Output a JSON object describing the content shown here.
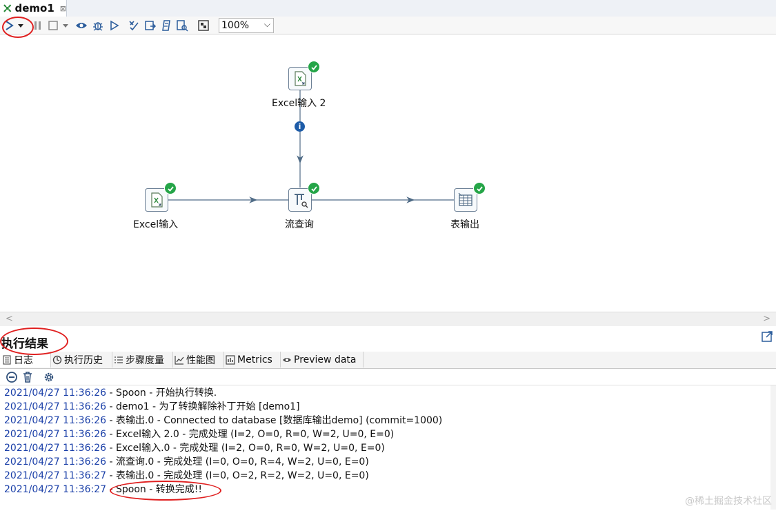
{
  "tab": {
    "title": "demo1",
    "close": "⊠"
  },
  "toolbar": {
    "zoom": "100%"
  },
  "canvas": {
    "nodes": [
      {
        "label": "Excel输入 2"
      },
      {
        "label": "Excel输入"
      },
      {
        "label": "流查询"
      },
      {
        "label": "表输出"
      }
    ],
    "info_badge": "i"
  },
  "results": {
    "title": "执行结果",
    "tabs": [
      {
        "label": "日志"
      },
      {
        "label": "执行历史"
      },
      {
        "label": "步骤度量"
      },
      {
        "label": "性能图"
      },
      {
        "label": "Metrics"
      },
      {
        "label": "Preview data"
      }
    ]
  },
  "log": [
    {
      "ts": "2021/04/27 11:36:26",
      "msg": " - Spoon - 开始执行转换."
    },
    {
      "ts": "2021/04/27 11:36:26",
      "msg": " - demo1 - 为了转换解除补丁开始  [demo1]"
    },
    {
      "ts": "2021/04/27 11:36:26",
      "msg": " - 表输出.0 - Connected to database [数据库输出demo] (commit=1000)"
    },
    {
      "ts": "2021/04/27 11:36:26",
      "msg": " - Excel输入 2.0 - 完成处理 (I=2, O=0, R=0, W=2, U=0, E=0)"
    },
    {
      "ts": "2021/04/27 11:36:26",
      "msg": " - Excel输入.0 - 完成处理 (I=2, O=0, R=0, W=2, U=0, E=0)"
    },
    {
      "ts": "2021/04/27 11:36:26",
      "msg": " - 流查询.0 - 完成处理 (I=0, O=0, R=4, W=2, U=0, E=0)"
    },
    {
      "ts": "2021/04/27 11:36:27",
      "msg": " - 表输出.0 - 完成处理 (I=0, O=2, R=2, W=2, U=0, E=0)"
    },
    {
      "ts": "2021/04/27 11:36:27",
      "msg": " - Spoon - 转换完成!!"
    }
  ],
  "watermark": "@稀土掘金技术社区"
}
